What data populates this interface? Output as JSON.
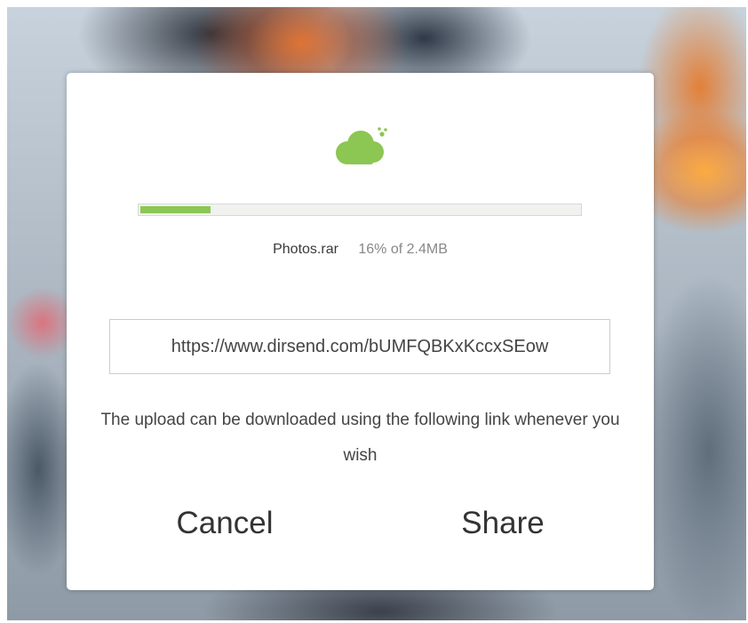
{
  "colors": {
    "accent_green": "#8cc653",
    "dialog_background": "#ffffff",
    "text": "#444444"
  },
  "dialog": {
    "icon": "cloud-upload-icon",
    "progress": {
      "fraction": 0.16
    },
    "file": {
      "name": "Photos.rar",
      "status": "16% of 2.4MB"
    },
    "link": {
      "value": "https://www.dirsend.com/bUMFQBKxKccxSEow"
    },
    "description": "The upload can be downloaded using the following link whenever you wish",
    "buttons": {
      "cancel_label": "Cancel",
      "share_label": "Share"
    }
  }
}
